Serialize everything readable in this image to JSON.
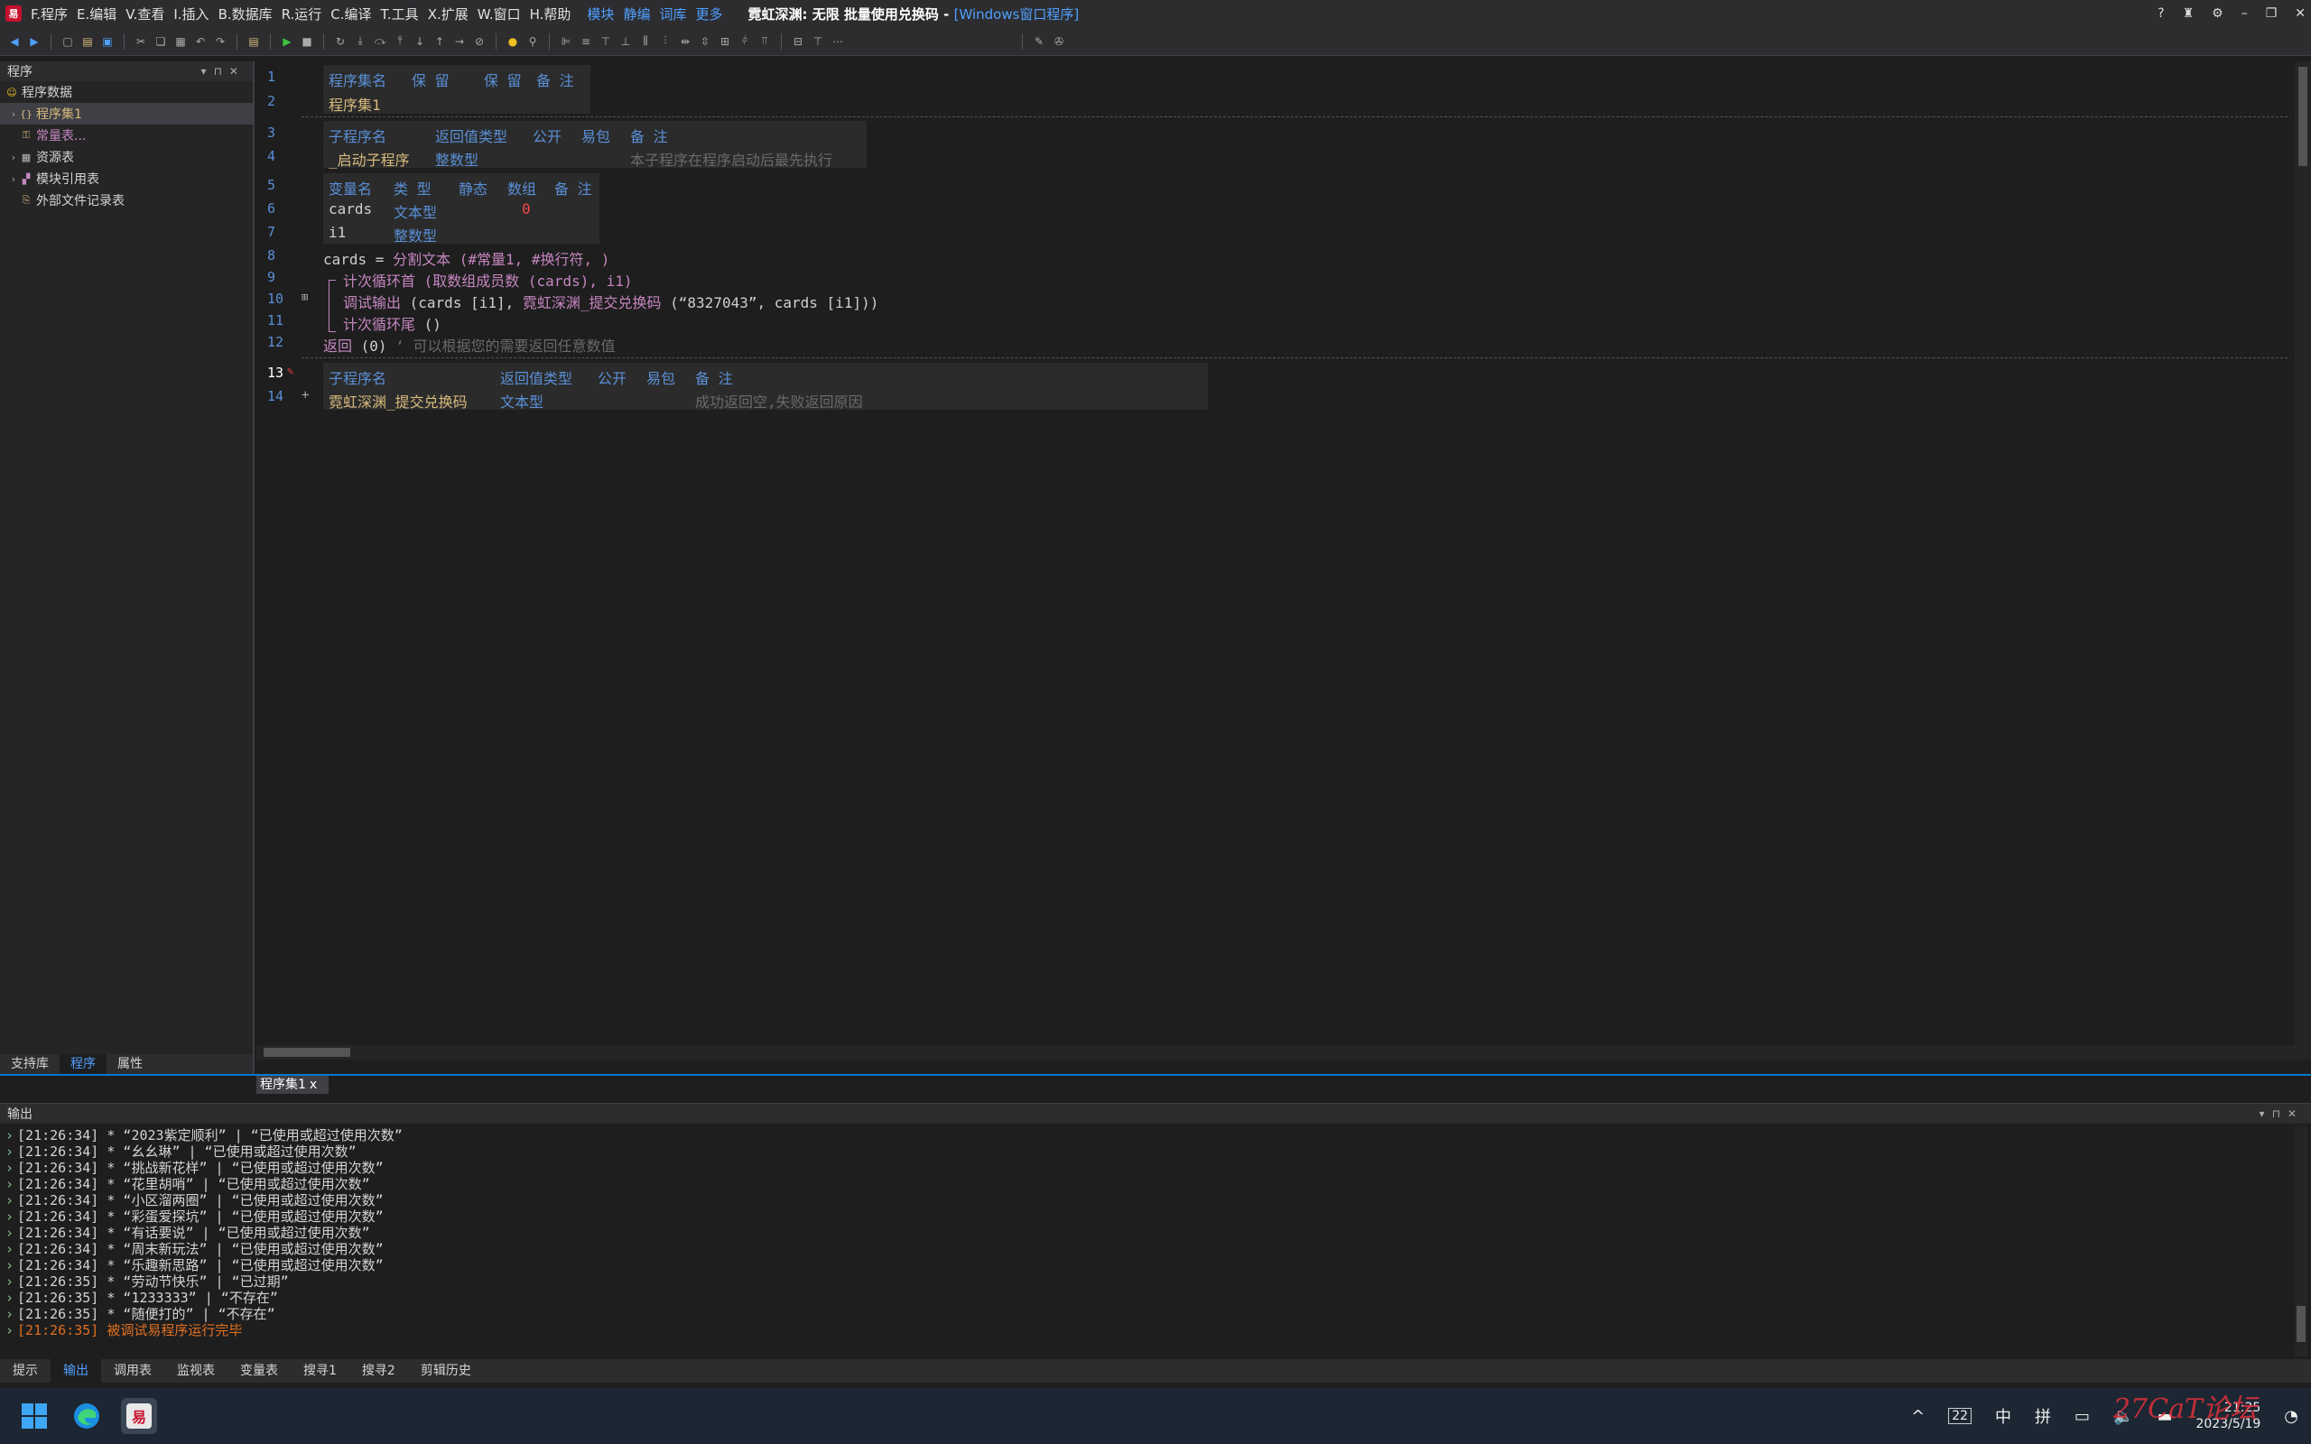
{
  "menubar": {
    "items": [
      "F.程序",
      "E.编辑",
      "V.查看",
      "I.插入",
      "B.数据库",
      "R.运行",
      "C.编译",
      "T.工具",
      "X.扩展",
      "W.窗口",
      "H.帮助"
    ],
    "blue_items": [
      "模块",
      "静编",
      "词库",
      "更多"
    ],
    "title_main": "霓虹深渊: 无限 批量使用兑换码 - ",
    "title_sub": "[Windows窗口程序]"
  },
  "leftpanel": {
    "header": "程序",
    "tree": [
      {
        "label": "程序数据",
        "indent": 0,
        "icon": "smiley-icon",
        "color": "#d4d4d4"
      },
      {
        "label": "程序集1",
        "indent": 1,
        "icon": "module-icon",
        "color": "#d7ba7d",
        "selected": true
      },
      {
        "label": "常量表...",
        "indent": 2,
        "icon": "constant-icon",
        "color": "#c586c0"
      },
      {
        "label": "资源表",
        "indent": 1,
        "icon": "resource-icon",
        "color": "#d4d4d4"
      },
      {
        "label": "模块引用表",
        "indent": 1,
        "icon": "module-ref-icon",
        "color": "#d4d4d4"
      },
      {
        "label": "外部文件记录表",
        "indent": 1,
        "icon": "external-file-icon",
        "color": "#d4d4d4"
      }
    ],
    "tabs": [
      "支持库",
      "程序",
      "属性"
    ]
  },
  "editor": {
    "line_numbers": [
      "1",
      "2",
      "3",
      "4",
      "5",
      "6",
      "7",
      "8",
      "9",
      "10",
      "11",
      "12",
      "13",
      "14"
    ],
    "t1": {
      "h1": "程序集名",
      "h2": "保 留",
      "h3": "保 留",
      "h4": "备 注",
      "v1": "程序集1"
    },
    "t2": {
      "h1": "子程序名",
      "h2": "返回值类型",
      "h3": "公开",
      "h4": "易包",
      "h5": "备 注",
      "v1": "_启动子程序",
      "v2": "整数型",
      "v5": "本子程序在程序启动后最先执行"
    },
    "t3": {
      "h1": "变量名",
      "h2": "类 型",
      "h3": "静态",
      "h4": "数组",
      "h5": "备 注",
      "r1c1": "cards",
      "r1c2": "文本型",
      "r1c4": "0",
      "r2c1": "i1",
      "r2c2": "整数型"
    },
    "line8": {
      "a": "cards",
      "b": " = ",
      "c": "分割文本",
      "d": " (#常量1, #换行符, )"
    },
    "line9": {
      "a": "计次循环首",
      "b": " (取数组成员数 (cards), i1)"
    },
    "line10": {
      "a": "调试输出",
      "b": " (cards [i1], ",
      "c": "霓虹深渊_提交兑换码",
      "d": " (",
      "e": "“8327043”",
      "f": ", cards [i1]))"
    },
    "line11": {
      "a": "计次循环尾",
      "b": " ()"
    },
    "line12": {
      "a": "返回",
      "b": " (0)",
      "c": "  ‘ 可以根据您的需要返回任意数值"
    },
    "t4": {
      "h1": "子程序名",
      "h2": "返回值类型",
      "h3": "公开",
      "h4": "易包",
      "h5": "备 注",
      "v1": "霓虹深渊_提交兑换码",
      "v2": "文本型",
      "v5": "成功返回空,失败返回原因"
    },
    "tab_label": "程序集1",
    "tab_close": "x"
  },
  "output": {
    "header": "输出",
    "lines": [
      "[21:26:34] * “2023紫定顺利” | “已使用或超过使用次数”",
      "[21:26:34] * “幺幺琳” | “已使用或超过使用次数”",
      "[21:26:34] * “挑战新花样” | “已使用或超过使用次数”",
      "[21:26:34] * “花里胡哨” | “已使用或超过使用次数”",
      "[21:26:34] * “小区溜两圈” | “已使用或超过使用次数”",
      "[21:26:34] * “彩蛋爱探坑” | “已使用或超过使用次数”",
      "[21:26:34] * “有话要说” | “已使用或超过使用次数”",
      "[21:26:34] * “周末新玩法” | “已使用或超过使用次数”",
      "[21:26:34] * “乐趣新思路” | “已使用或超过使用次数”",
      "[21:26:35] * “劳动节快乐” | “已过期”",
      "[21:26:35] * “1233333” | “不存在”",
      "[21:26:35] * “随便打的” | “不存在”"
    ],
    "final_line": "[21:26:35] 被调试易程序运行完毕",
    "bottom_tabs": [
      "提示",
      "输出",
      "调用表",
      "监视表",
      "变量表",
      "搜寻1",
      "搜寻2",
      "剪辑历史"
    ]
  },
  "taskbar": {
    "tray": [
      "^",
      "22",
      "中",
      "拼"
    ],
    "time": "21:25",
    "date": "2023/5/19"
  },
  "watermark": "27CaT论坛"
}
